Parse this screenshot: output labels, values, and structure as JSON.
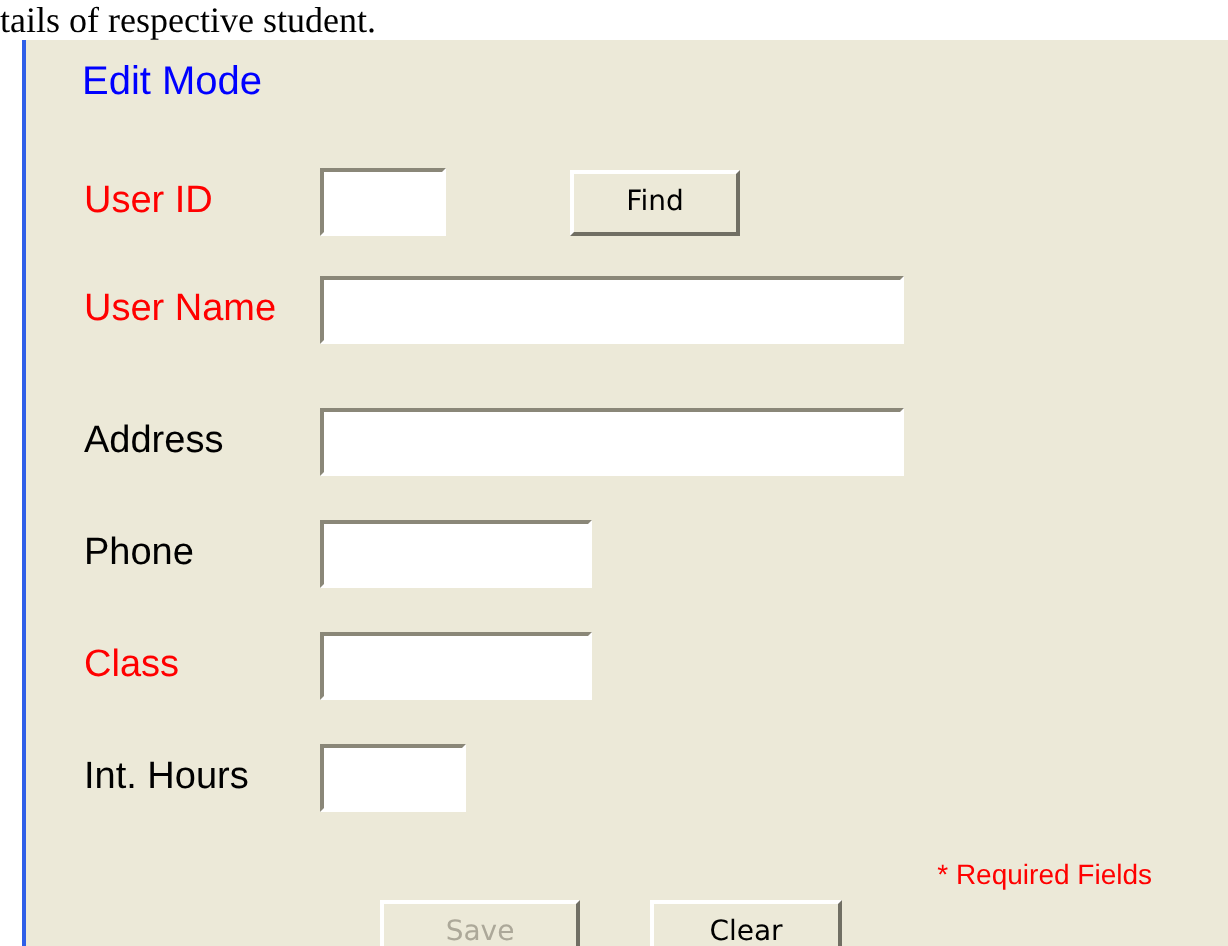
{
  "caption": "tails of respective student.",
  "form": {
    "title": "Edit Mode",
    "fields": [
      {
        "label": "User ID",
        "required": true,
        "kind": "small",
        "button": {
          "label": "Find",
          "disabled": false
        }
      },
      {
        "label": "User Name",
        "required": true,
        "kind": "large"
      },
      {
        "label": "Address",
        "required": false,
        "kind": "large"
      },
      {
        "label": "Phone",
        "required": false,
        "kind": "medium"
      },
      {
        "label": "Class",
        "required": true,
        "kind": "medium"
      },
      {
        "label": "Int. Hours",
        "required": false,
        "kind": "tiny"
      }
    ],
    "note": "* Required Fields",
    "buttons": [
      {
        "label": "Save",
        "disabled": true
      },
      {
        "label": "Clear",
        "disabled": false
      }
    ]
  }
}
